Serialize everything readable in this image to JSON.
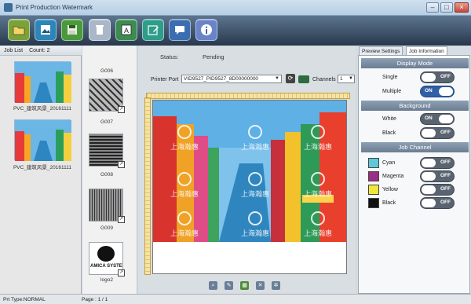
{
  "window": {
    "title": "Print Production Watermark",
    "min": "–",
    "max": "□",
    "close": "×"
  },
  "toolbar": {
    "buttons": [
      {
        "name": "open-folder-button",
        "icon": "folder-open-icon",
        "color": "#6d8f2b"
      },
      {
        "name": "import-image-button",
        "icon": "image-import-icon",
        "color": "#2d86b8"
      },
      {
        "name": "save-button",
        "icon": "floppy-disk-icon",
        "color": "#4a9a3c"
      },
      {
        "name": "delete-button",
        "icon": "trash-icon",
        "color": "#a9b7c9"
      },
      {
        "name": "text-button",
        "icon": "text-frame-icon",
        "color": "#3c8c52"
      },
      {
        "name": "edit-button",
        "icon": "pencil-icon",
        "color": "#2e9d8a"
      },
      {
        "name": "message-button",
        "icon": "chat-bubble-icon",
        "color": "#3a6eb0"
      },
      {
        "name": "info-button",
        "icon": "info-icon",
        "color": "#6a84c9"
      }
    ]
  },
  "joblist": {
    "title": "Job List",
    "count_label": "Count: 2",
    "jobs": [
      {
        "caption": "PVC_建筑风景_20161111"
      },
      {
        "caption": "PVC_建筑风景_20161111"
      }
    ]
  },
  "watermarks": {
    "items": [
      {
        "caption": "G006"
      },
      {
        "caption": "G007"
      },
      {
        "caption": "G008"
      },
      {
        "caption": "G009"
      },
      {
        "caption": "logo2",
        "logo_text": "AMICA SYSTE"
      }
    ]
  },
  "center": {
    "status_label": "Status:",
    "status_value": "Pending",
    "printer_port_label": "Printer Port",
    "printer_port_value": "VID9527_PID9527_8D00000000",
    "channels_label": "Channels",
    "channels_value": "1",
    "watermark_text": "上海瀚惠",
    "watermark_sub": "COSMOINKJET"
  },
  "rightpanel": {
    "tabs": [
      "Preview Settings",
      "Job Information"
    ],
    "display_mode": {
      "title": "Display Mode",
      "rows": [
        {
          "label": "Single",
          "state": "OFF"
        },
        {
          "label": "Multiple",
          "state": "ON"
        }
      ]
    },
    "background": {
      "title": "Background",
      "rows": [
        {
          "label": "White",
          "state": "ON"
        },
        {
          "label": "Black",
          "state": "OFF"
        }
      ]
    },
    "job_channel": {
      "title": "Job Channel",
      "rows": [
        {
          "label": "Cyan",
          "state": "OFF",
          "color": "#5ec7d8"
        },
        {
          "label": "Magenta",
          "state": "OFF",
          "color": "#9b2d86"
        },
        {
          "label": "Yellow",
          "state": "OFF",
          "color": "#f3e63a"
        },
        {
          "label": "Black",
          "state": "OFF",
          "color": "#111111"
        }
      ]
    }
  },
  "statusbar": {
    "print_type": "Prt Type:NORMAL",
    "page": "Page : 1 / 1"
  }
}
